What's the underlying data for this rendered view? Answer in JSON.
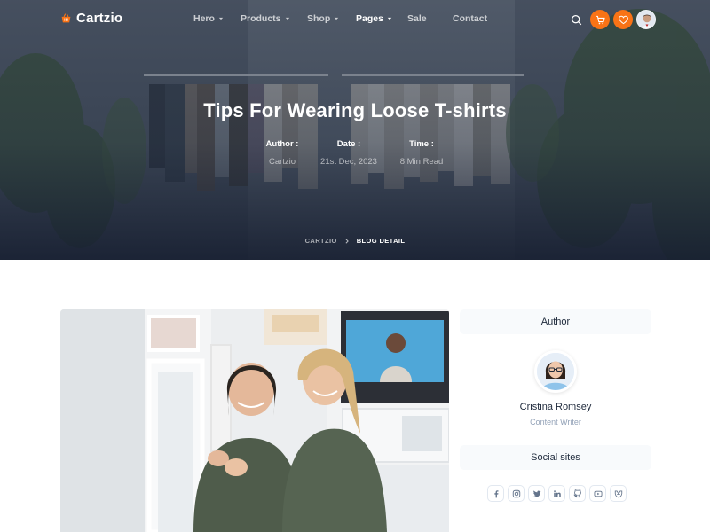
{
  "brand": {
    "name": "Cartzio",
    "accent": "#f97316"
  },
  "nav": {
    "items": [
      {
        "label": "Hero",
        "has_dropdown": true
      },
      {
        "label": "Products",
        "has_dropdown": true
      },
      {
        "label": "Shop",
        "has_dropdown": true
      },
      {
        "label": "Pages",
        "has_dropdown": true,
        "active": true
      },
      {
        "label": "Sale",
        "has_dropdown": false
      },
      {
        "label": "Contact",
        "has_dropdown": false
      }
    ],
    "icons": [
      "search-icon",
      "cart-icon",
      "heart-icon",
      "user-avatar"
    ]
  },
  "hero": {
    "title": "Tips For Wearing Loose T-shirts",
    "meta": [
      {
        "label": "Author :",
        "value": "Cartzio"
      },
      {
        "label": "Date :",
        "value": "21st Dec, 2023"
      },
      {
        "label": "Time :",
        "value": "8 Min Read"
      }
    ],
    "breadcrumb": {
      "home": "CARTZIO",
      "current": "BLOG DETAIL"
    }
  },
  "sidebar": {
    "author_heading": "Author",
    "author": {
      "name": "Cristina Romsey",
      "role": "Content Writer"
    },
    "social_heading": "Social sites",
    "social_icons": [
      "facebook-icon",
      "instagram-icon",
      "twitter-icon",
      "linkedin-icon",
      "github-icon",
      "youtube-icon",
      "dribbble-icon"
    ]
  }
}
